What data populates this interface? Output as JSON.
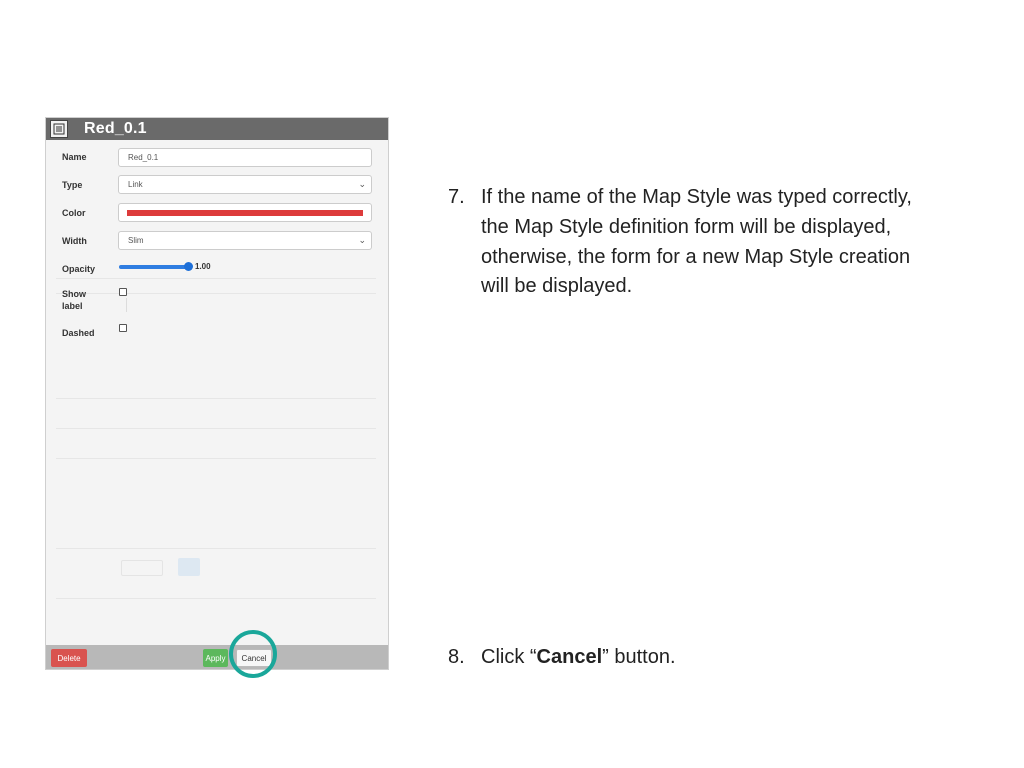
{
  "dialog": {
    "title": "Red_0.1",
    "fields": {
      "name": {
        "label": "Name",
        "value": "Red_0.1"
      },
      "type": {
        "label": "Type",
        "value": "Link"
      },
      "color": {
        "label": "Color",
        "value": "#dd3b3b"
      },
      "width": {
        "label": "Width",
        "value": "Slim"
      },
      "opacity": {
        "label": "Opacity",
        "value": "1.00",
        "level": 1.0
      },
      "show_label": {
        "label_line1": "Show",
        "label_line2": "label",
        "checked": false
      },
      "dashed": {
        "label": "Dashed",
        "checked": false
      }
    },
    "buttons": {
      "delete": "Delete",
      "apply": "Apply",
      "cancel": "Cancel"
    }
  },
  "instructions": {
    "step7": {
      "number": "7.",
      "lines": [
        "If the name of the Map Style was typed correctly,",
        "the Map Style definition form will be displayed,",
        "otherwise, the form for a new Map Style creation",
        "will be displayed."
      ]
    },
    "step8": {
      "number": "8.",
      "prefix": "Click “",
      "bold": "Cancel",
      "suffix": "” button."
    }
  },
  "colors": {
    "header": "#6a6a6a",
    "delete": "#d9534f",
    "apply": "#5cb85c",
    "highlight": "#1aa79a",
    "opacity_slider": "#2f7de1"
  },
  "icons": {
    "form": "form-list-icon",
    "select": "chevron-down-icon"
  }
}
